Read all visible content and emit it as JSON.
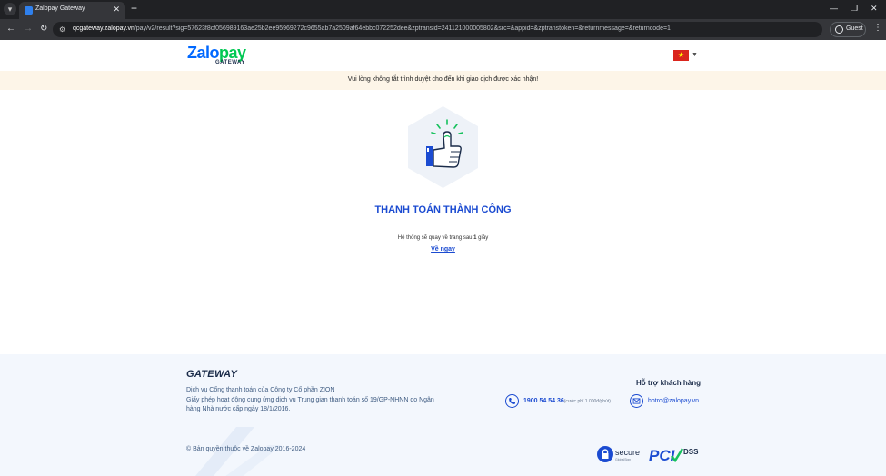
{
  "browser": {
    "tab_title": "Zalopay Gateway",
    "url_host": "qcgateway.zalopay.vn",
    "url_path": "/pay/v2/result?sig=57623f8cf056989163ae25b2ee95969272c9655ab7a2509af64ebbc072252dee&zptransid=241121000005802&src=&appid=&zptranstoken=&returnmessage=&returncode=1",
    "profile_label": "Guest"
  },
  "header": {
    "logo_main": "Zalo",
    "logo_pay": "pay",
    "logo_sub": "GATEWAY",
    "language_flag": "vietnam-flag-icon"
  },
  "notice": {
    "text": "Vui lòng không tắt trình duyệt cho đến khi giao dịch được xác nhận!"
  },
  "result": {
    "title": "THANH TOÁN THÀNH CÔNG",
    "redirect_before": "Hệ thống sẽ quay về trang sau ",
    "redirect_seconds": "1",
    "redirect_after": " giây",
    "back_link": "Về ngay"
  },
  "footer": {
    "brand": "GATEWAY",
    "company": "Dịch vụ Cổng thanh toán của Công ty Cổ phần ZION",
    "license": "Giấy phép hoạt động cung ứng dịch vụ Trung gian thanh toán số 19/GP-NHNN do Ngân hàng Nhà nước cấp ngày 18/1/2016.",
    "copyright": "© Bản quyền thuộc về Zalopay 2016-2024",
    "support_title": "Hỗ trợ khách hàng",
    "phone": "1900 54 54 36",
    "phone_note": "(cước phí 1.000đ/phút)",
    "email": "hotro@zalopay.vn",
    "badge_secure_text": "secure",
    "badge_secure_sub": "GlobalSign",
    "badge_pci_text": "PCI",
    "badge_dss_text": "DSS"
  },
  "colors": {
    "primary": "#1b4bd1",
    "zalo_blue": "#0068ff",
    "pay_green": "#00c853",
    "notice_bg": "#fdf5e8",
    "footer_bg": "#f3f7fd"
  }
}
